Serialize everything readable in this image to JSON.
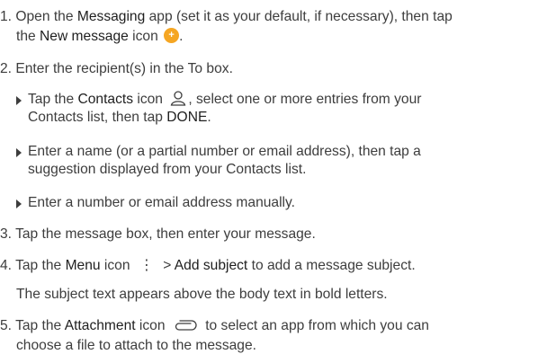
{
  "steps": {
    "s1": {
      "num": "1.",
      "t1": "Open the ",
      "b1": "Messaging",
      "t2": " app (set it as your default, if necessary), then tap",
      "t3": "the ",
      "b2": "New message",
      "t4": " icon ",
      "icon": "new-message-icon",
      "t5": "."
    },
    "s2": {
      "num": "2.",
      "text": "Enter the recipient(s) in the To box.",
      "bullets": {
        "a": {
          "t1": "Tap the ",
          "b1": "Contacts",
          "t2": " icon ",
          "icon": "contacts-icon",
          "t3": ", select one or more entries from your",
          "t4": "Contacts list, then tap ",
          "b2": "DONE",
          "t5": "."
        },
        "b": {
          "l1": "Enter a name (or a partial number or email address), then tap a",
          "l2": "suggestion displayed from your Contacts list."
        },
        "c": {
          "l1": "Enter a number or email address manually."
        }
      }
    },
    "s3": {
      "num": "3.",
      "text": "Tap the message box, then enter your message."
    },
    "s4": {
      "num": "4.",
      "t1": "Tap the ",
      "b1": "Menu",
      "t2": " icon ",
      "icon": "menu-icon",
      "glyph": "⋮",
      "t3": " > ",
      "b2": "Add subject",
      "t4": " to add a message subject.",
      "note": "The subject text appears above the body text in bold letters."
    },
    "s5": {
      "num": "5.",
      "t1": "Tap the ",
      "b1": "Attachment",
      "t2": " icon ",
      "icon": "attachment-icon",
      "t3": " to select an app from which you can",
      "t4": "choose a file to attach to the message."
    }
  },
  "colors": {
    "accent": "#f5a623",
    "text": "#3d3d3d"
  }
}
